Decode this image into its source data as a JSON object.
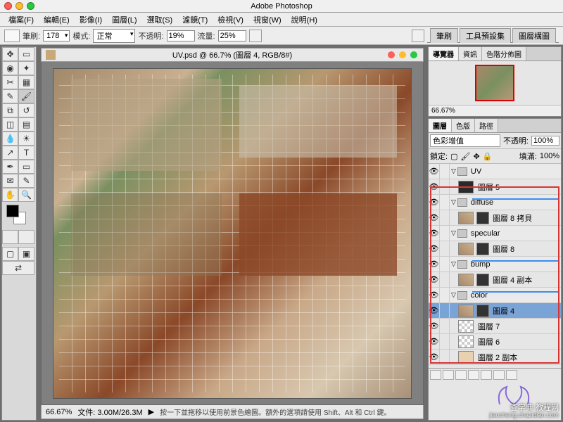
{
  "app": {
    "title": "Adobe Photoshop"
  },
  "menu": [
    "檔案(F)",
    "編輯(E)",
    "影像(I)",
    "圖層(L)",
    "選取(S)",
    "濾鏡(T)",
    "檢視(V)",
    "視窗(W)",
    "說明(H)"
  ],
  "optbar": {
    "brush_label": "筆刷:",
    "brush_size": "178",
    "mode_label": "模式:",
    "mode_value": "正常",
    "opacity_label": "不透明:",
    "opacity_value": "19%",
    "flow_label": "流量:",
    "flow_value": "25%"
  },
  "palette_tabs": [
    "筆刷",
    "工具預設集",
    "圖層構圖"
  ],
  "document": {
    "title": "UV.psd @ 66.7% (圖層 4, RGB/8#)",
    "zoom": "66.67%",
    "filesize": "文件: 3.00M/26.3M",
    "hint": "按一下並拖移以使用前景色繪圖。額外的選項請使用 Shift、Alt 和 Ctrl 鍵。"
  },
  "navigator": {
    "tabs": [
      "導覽器",
      "資訊",
      "色階分佈圖"
    ],
    "zoom": "66.67%"
  },
  "layers_panel": {
    "tabs": [
      "圖層",
      "色版",
      "路徑"
    ],
    "blend_label": "色彩增值",
    "opacity_label": "不透明:",
    "opacity_value": "100%",
    "lock_label": "鎖定:",
    "fill_label": "填滿:",
    "fill_value": "100%",
    "layers": [
      {
        "type": "group",
        "name": "UV",
        "indent": 0,
        "open": true
      },
      {
        "type": "layer",
        "name": "圖層 5",
        "indent": 1,
        "thumb": "dk"
      },
      {
        "type": "group",
        "name": "diffuse",
        "indent": 0,
        "open": true,
        "blue": true
      },
      {
        "type": "layer",
        "name": "圖層 8 拷貝",
        "indent": 1,
        "thumb": "tex",
        "mask": true
      },
      {
        "type": "group",
        "name": "specular",
        "indent": 0,
        "open": true
      },
      {
        "type": "layer",
        "name": "圖層 8",
        "indent": 1,
        "thumb": "tex",
        "mask": true
      },
      {
        "type": "group",
        "name": "bump",
        "indent": 0,
        "open": true,
        "blue": true
      },
      {
        "type": "layer",
        "name": "圖層 4 副本",
        "indent": 1,
        "thumb": "tex",
        "mask": true
      },
      {
        "type": "group",
        "name": "color",
        "indent": 0,
        "open": true,
        "blue": true
      },
      {
        "type": "layer",
        "name": "圖層 4",
        "indent": 1,
        "thumb": "tex",
        "mask": true,
        "selected": true
      },
      {
        "type": "layer",
        "name": "圖層 7",
        "indent": 1,
        "thumb": "chk"
      },
      {
        "type": "layer",
        "name": "圖層 6",
        "indent": 1,
        "thumb": "chk"
      },
      {
        "type": "layer",
        "name": "圖層 2 副本",
        "indent": 1,
        "thumb": "tan"
      }
    ]
  },
  "icons": {
    "eye": "👁",
    "fold_open": "▽",
    "fold_closed": "▷",
    "arrow": "▶"
  },
  "watermark": {
    "main": "查字典 教程网",
    "sub": "jiaocheng.chazidian.com"
  }
}
